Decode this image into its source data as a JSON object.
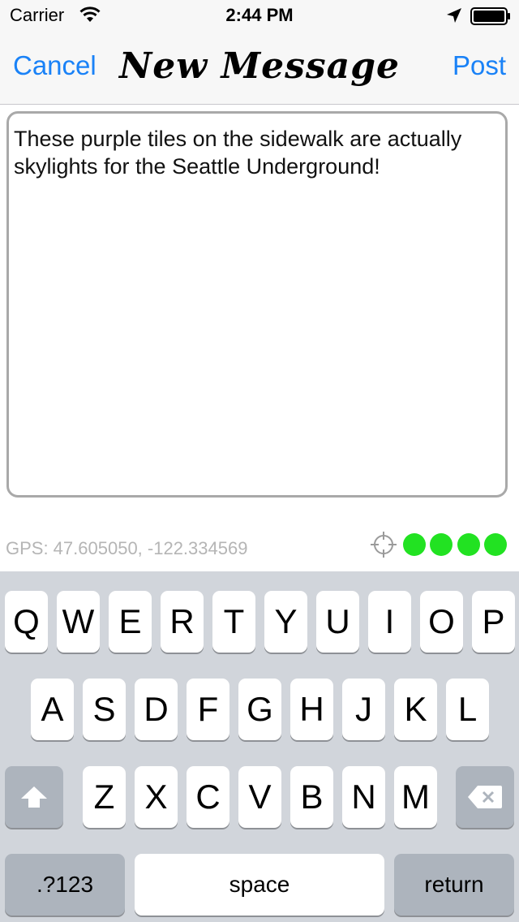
{
  "status_bar": {
    "carrier": "Carrier",
    "time": "2:44 PM",
    "wifi_icon": "wifi-icon",
    "location_icon": "location-arrow-icon",
    "battery_icon": "battery-icon"
  },
  "nav": {
    "cancel_label": "Cancel",
    "title": "New Message",
    "post_label": "Post",
    "accent_color": "#1a82f7"
  },
  "message": {
    "text": "These purple tiles on the sidewalk are actually skylights for the Seattle Underground!"
  },
  "gps": {
    "label": "GPS: 47.605050, -122.334569",
    "crosshair_icon": "crosshair-icon",
    "signal_dots": 4,
    "signal_color": "#22e222"
  },
  "keyboard": {
    "row1": [
      "Q",
      "W",
      "E",
      "R",
      "T",
      "Y",
      "U",
      "I",
      "O",
      "P"
    ],
    "row2": [
      "A",
      "S",
      "D",
      "F",
      "G",
      "H",
      "J",
      "K",
      "L"
    ],
    "row3": [
      "Z",
      "X",
      "C",
      "V",
      "B",
      "N",
      "M"
    ],
    "shift_icon": "shift-icon",
    "backspace_icon": "backspace-icon",
    "numbers_label": ".?123",
    "space_label": "space",
    "return_label": "return"
  }
}
